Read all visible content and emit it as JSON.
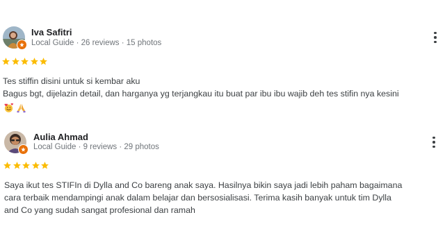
{
  "reviews": [
    {
      "name": "Iva Safitri",
      "meta": "Local Guide · 26 reviews · 15 photos",
      "rating": 5,
      "text_lines": [
        "Tes stiffin disini untuk si kembar aku",
        "Bagus bgt, dijelazin detail, dan harganya yg terjangkau itu buat par ibu ibu wajib deh tes stifin nya kesini"
      ],
      "emojis": [
        "face-with-hearts-icon",
        "folded-hands-icon"
      ]
    },
    {
      "name": "Aulia Ahmad",
      "meta": "Local Guide · 9 reviews · 29 photos",
      "rating": 5,
      "text_lines": [
        "Saya ikut tes STIFIn di Dylla and Co bareng anak saya. Hasilnya bikin saya jadi lebih paham bagaimana",
        "cara terbaik mendampingi anak dalam belajar dan bersosialisasi. Terima kasih banyak untuk tim Dylla",
        "and Co yang sudah sangat profesional dan ramah"
      ]
    }
  ],
  "colors": {
    "star": "#fbbc04",
    "guide_badge": "#e8710a",
    "meta_text": "#70757a"
  },
  "icons": [
    "star-icon",
    "more-options-icon",
    "local-guide-badge-icon"
  ]
}
